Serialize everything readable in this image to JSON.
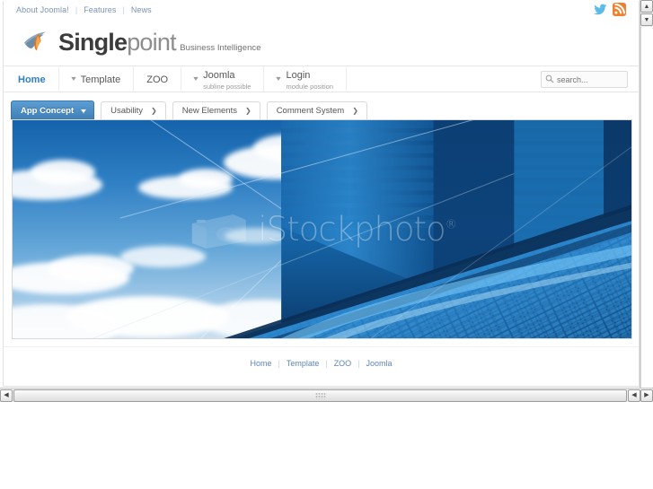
{
  "window": {
    "title": "Singlepoint - Business Intelligence"
  },
  "topnav": {
    "items": [
      {
        "label": "About Joomla!"
      },
      {
        "label": "Features"
      },
      {
        "label": "News"
      }
    ],
    "separator": "|",
    "social": [
      {
        "name": "twitter-icon",
        "color": "#55acee"
      },
      {
        "name": "rss-icon",
        "color": "#ee802f"
      }
    ]
  },
  "logo": {
    "word_bold": "Single",
    "word_light": "point",
    "tagline": "Business Intelligence",
    "mark_color": "#7d9ab5",
    "mark_accent": "#e8751a"
  },
  "mainmenu": {
    "items": [
      {
        "label": "Home",
        "sub": "",
        "chevron": false,
        "active": true
      },
      {
        "label": "Template",
        "sub": "",
        "chevron": true,
        "active": false
      },
      {
        "label": "ZOO",
        "sub": "",
        "chevron": false,
        "active": false
      },
      {
        "label": "Joomla",
        "sub": "subline possible",
        "chevron": true,
        "active": false
      },
      {
        "label": "Login",
        "sub": "module position",
        "chevron": true,
        "active": false
      }
    ],
    "active_color": "#2f7fc1"
  },
  "search": {
    "icon": "search-icon",
    "placeholder": "search...",
    "value": ""
  },
  "tabs": {
    "items": [
      {
        "label": "App Concept",
        "arrow": "❯",
        "active": true
      },
      {
        "label": "Usability",
        "arrow": "❯",
        "active": false
      },
      {
        "label": "New Elements",
        "arrow": "❯",
        "active": false
      },
      {
        "label": "Comment System",
        "arrow": "❯",
        "active": false
      }
    ],
    "active_bg": "#3f7fb6"
  },
  "hero": {
    "alt": "Blue sky with clouds and glass office skyscraper",
    "watermark_text": "iStockphoto",
    "watermark_mark": "®",
    "sky_color": "#2f7fc4",
    "building_color": "#15568f"
  },
  "footer": {
    "items": [
      {
        "label": "Home"
      },
      {
        "label": "Template"
      },
      {
        "label": "ZOO"
      },
      {
        "label": "Joomla"
      }
    ],
    "separator": "|"
  },
  "scrollbars": {
    "vertical": {
      "up": "▲",
      "down": "▼"
    },
    "horizontal": {
      "left": "◀",
      "right": "▶"
    }
  }
}
